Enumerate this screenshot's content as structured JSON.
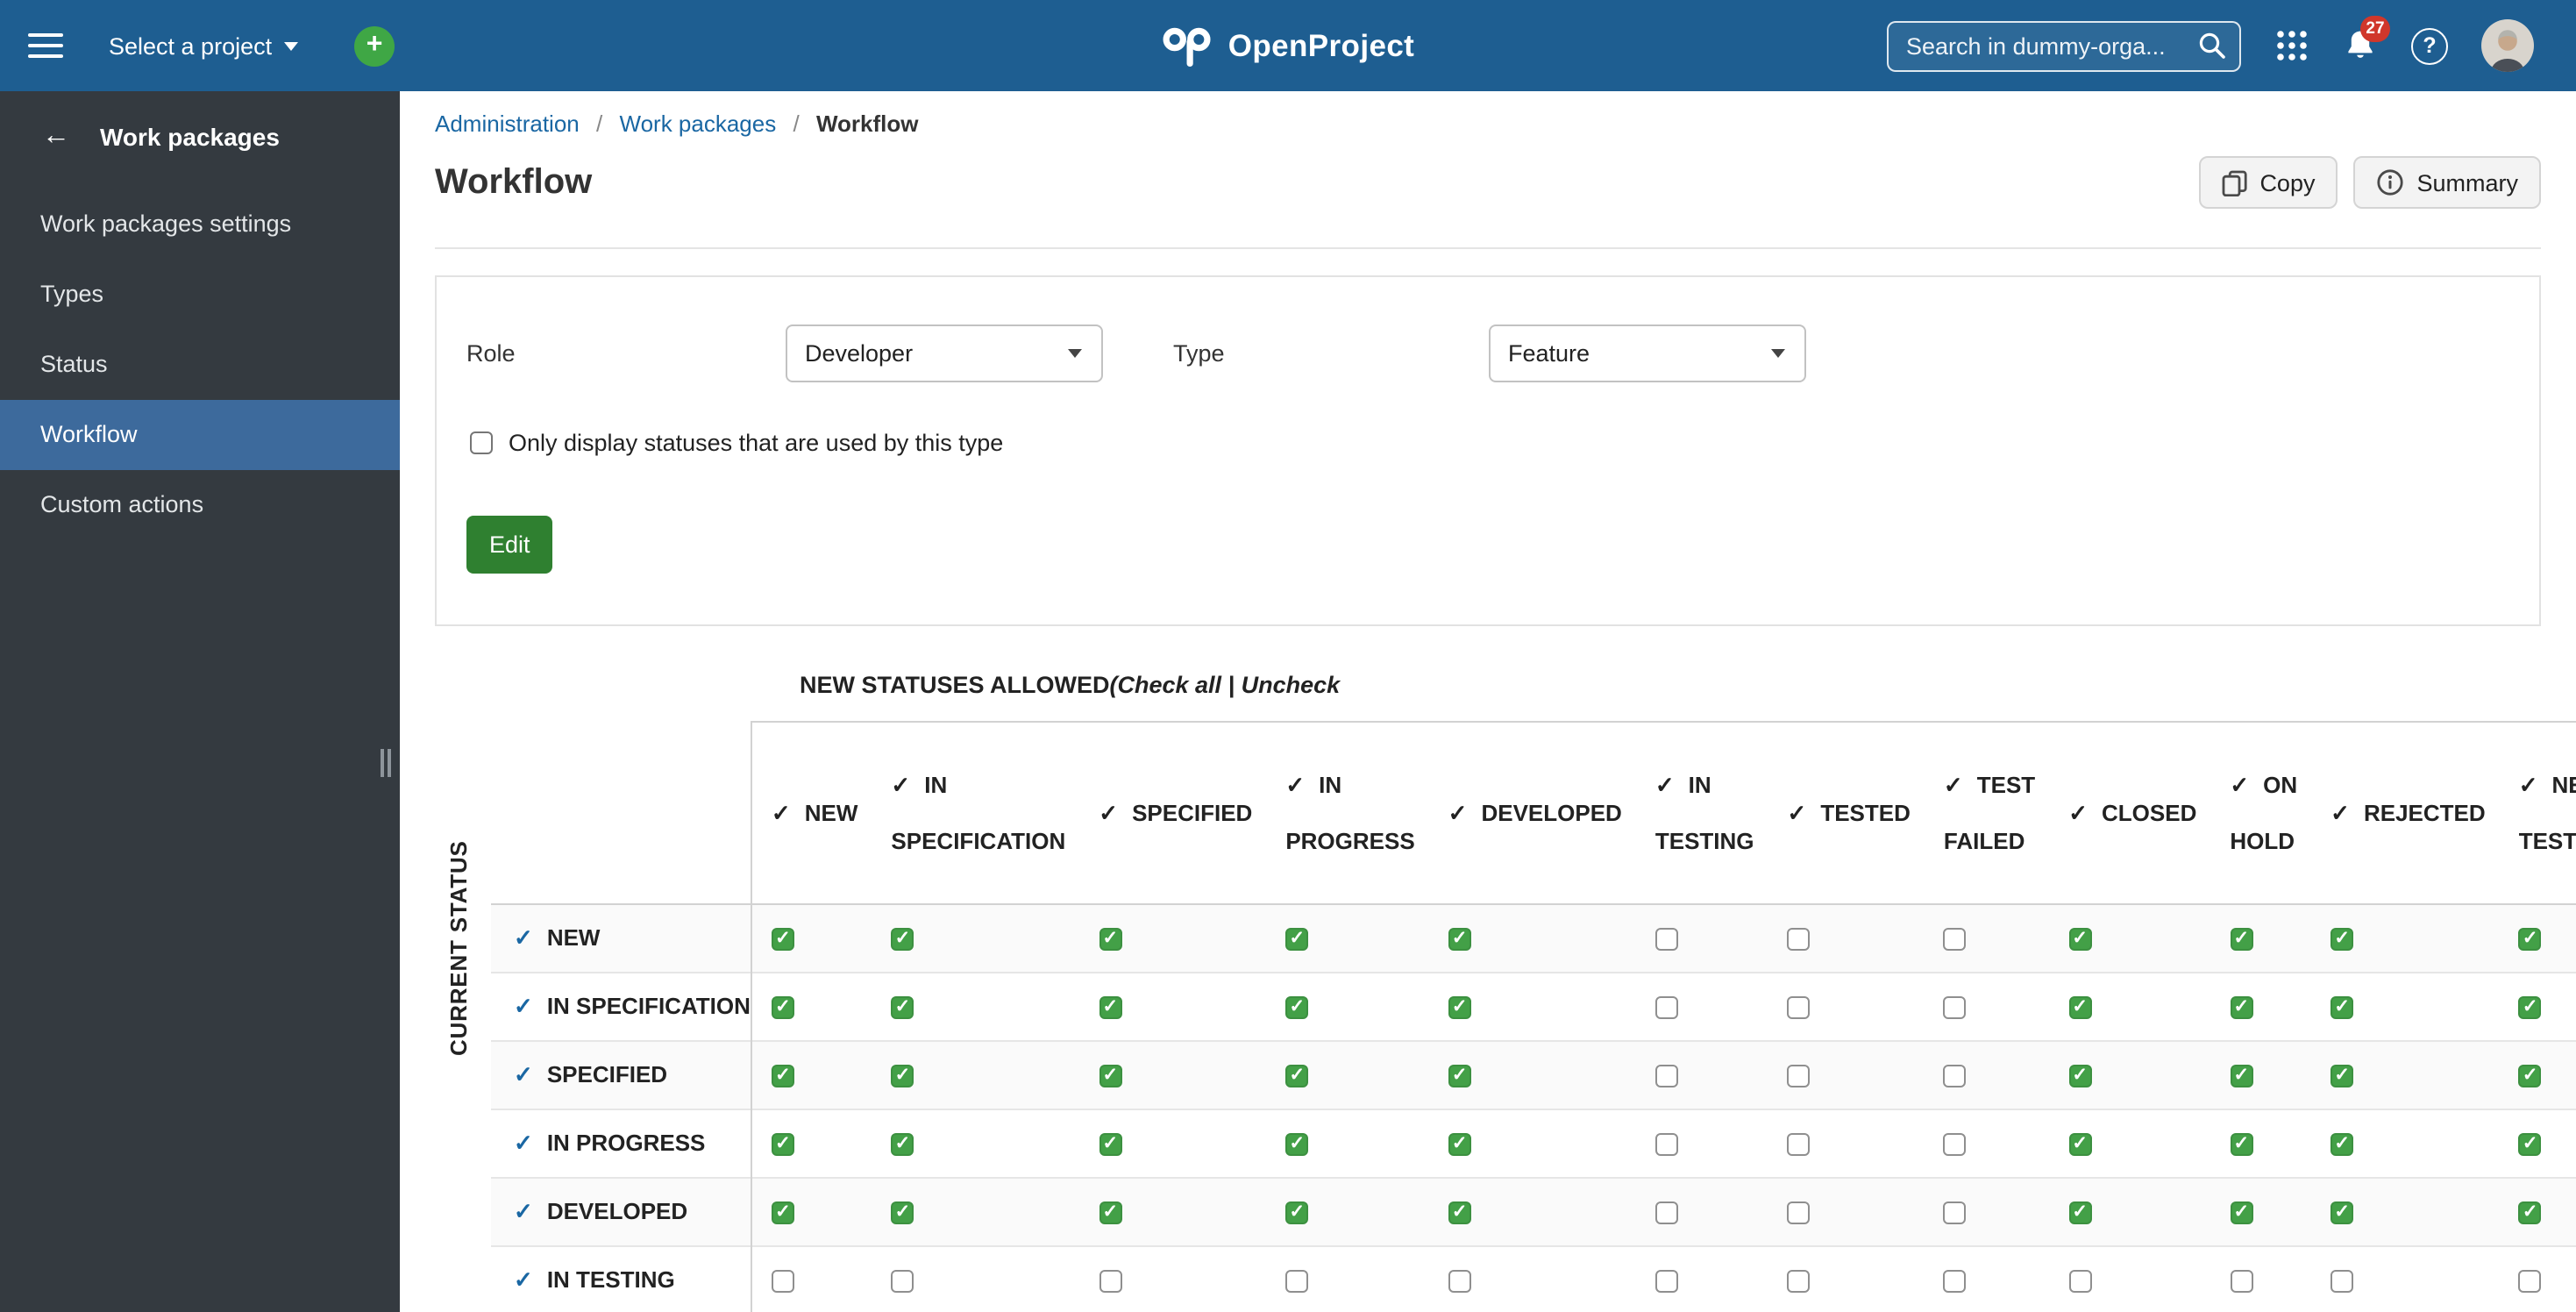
{
  "icons": {
    "plus": "+",
    "check": "✓",
    "back_arrow": "←",
    "question": "?"
  },
  "colors": {
    "header_bg": "#1e5e91",
    "accent": "#1a67a3",
    "add_green": "#3fa745",
    "badge_red": "#d0372b",
    "edit_green": "#2f8030",
    "checked_green": "#43a047",
    "sidebar_bg": "#343a40",
    "sidebar_active": "#3d6a9c"
  },
  "topbar": {
    "select_project_label": "Select a project",
    "logo_text": "OpenProject",
    "search_placeholder": "Search in dummy-orga...",
    "notification_count": "27"
  },
  "sidebar": {
    "title": "Work packages",
    "items": [
      {
        "label": "Work packages settings"
      },
      {
        "label": "Types"
      },
      {
        "label": "Status"
      },
      {
        "label": "Workflow",
        "active": true
      },
      {
        "label": "Custom actions"
      }
    ]
  },
  "breadcrumb": {
    "separator": "/",
    "items": [
      {
        "label": "Administration"
      },
      {
        "label": "Work packages"
      },
      {
        "label": "Workflow"
      }
    ]
  },
  "page_title": "Workflow",
  "toolbar": {
    "copy_label": "Copy",
    "summary_label": "Summary"
  },
  "filter_form": {
    "role_label": "Role",
    "role_value": "Developer",
    "type_label": "Type",
    "type_value": "Feature",
    "only_display_label": "Only display statuses that are used by this type",
    "only_display_checked": false,
    "edit_label": "Edit"
  },
  "workflow_table": {
    "heading_bold": "NEW STATUSES ALLOWED",
    "heading_italic": "(Check all | Uncheck",
    "left_axis_label": "CURRENT STATUS",
    "columns": [
      "NEW",
      "IN SPECIFICATION",
      "SPECIFIED",
      "IN PROGRESS",
      "DEVELOPED",
      "IN TESTING",
      "TESTED",
      "TEST FAILED",
      "CLOSED",
      "ON HOLD",
      "REJECTED",
      "NEEDS TESTING"
    ],
    "rows": [
      {
        "label": "NEW",
        "checked": [
          true,
          true,
          true,
          true,
          true,
          false,
          false,
          false,
          true,
          true,
          true,
          true
        ]
      },
      {
        "label": "IN SPECIFICATION",
        "checked": [
          true,
          true,
          true,
          true,
          true,
          false,
          false,
          false,
          true,
          true,
          true,
          true
        ]
      },
      {
        "label": "SPECIFIED",
        "checked": [
          true,
          true,
          true,
          true,
          true,
          false,
          false,
          false,
          true,
          true,
          true,
          true
        ]
      },
      {
        "label": "IN PROGRESS",
        "checked": [
          true,
          true,
          true,
          true,
          true,
          false,
          false,
          false,
          true,
          true,
          true,
          true
        ]
      },
      {
        "label": "DEVELOPED",
        "checked": [
          true,
          true,
          true,
          true,
          true,
          false,
          false,
          false,
          true,
          true,
          true,
          true
        ]
      },
      {
        "label": "IN TESTING",
        "checked": [
          false,
          false,
          false,
          false,
          false,
          false,
          false,
          false,
          false,
          false,
          false,
          false
        ]
      }
    ]
  }
}
